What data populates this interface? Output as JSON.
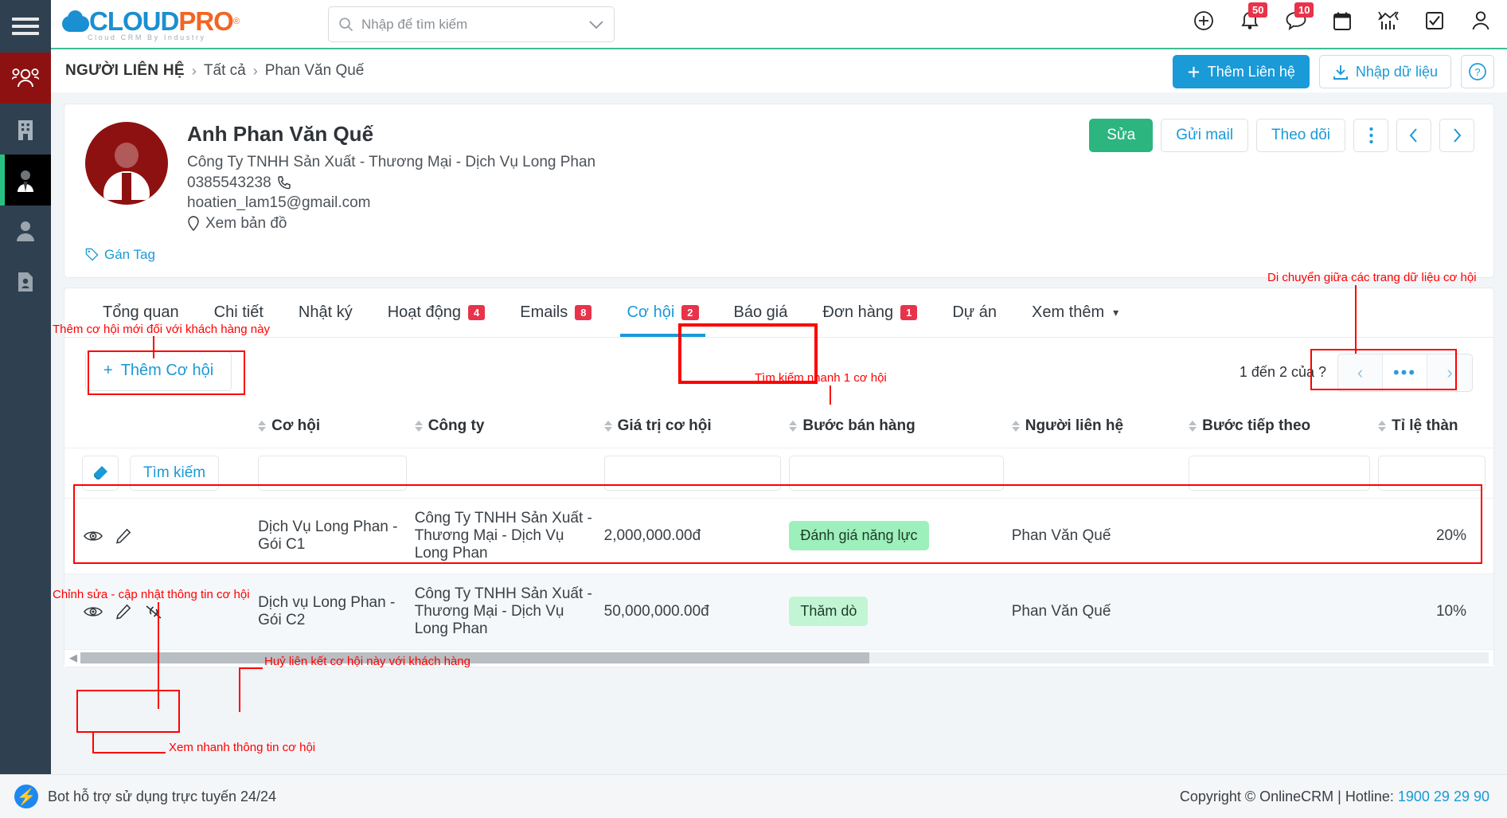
{
  "app": {
    "logo_text_1": "CLOUD",
    "logo_text_2": "PRO",
    "logo_reg": "®",
    "logo_sub": "Cloud CRM By Industry"
  },
  "search": {
    "placeholder": "Nhập để tìm kiếm",
    "value": ""
  },
  "topicons": [
    {
      "name": "add-circle-icon",
      "badge": ""
    },
    {
      "name": "bell-icon",
      "badge": "50"
    },
    {
      "name": "chat-icon",
      "badge": "10"
    },
    {
      "name": "calendar-icon",
      "badge": ""
    },
    {
      "name": "chart-icon",
      "badge": ""
    },
    {
      "name": "checkbox-icon",
      "badge": ""
    },
    {
      "name": "user-icon",
      "badge": ""
    }
  ],
  "breadcrumb": {
    "module": "NGƯỜI LIÊN HỆ",
    "sep": "›",
    "level1": "Tất cả",
    "level2": "Phan Văn Quế"
  },
  "breadcrumb_actions": {
    "add_contact": "Thêm Liên hệ",
    "import_data": "Nhập dữ liệu",
    "help": "?"
  },
  "contact": {
    "name": "Anh Phan Văn Quế",
    "company": "Công Ty TNHH Sản Xuất - Thương Mại - Dịch Vụ Long Phan",
    "phone": "0385543238",
    "email": "hoatien_lam15@gmail.com",
    "map_link": "Xem bản đồ",
    "tag_link": "Gán Tag",
    "actions": {
      "edit": "Sửa",
      "send_mail": "Gửi mail",
      "follow": "Theo dõi",
      "more": "⋮",
      "prev": "‹",
      "next": "›"
    }
  },
  "tabs": [
    {
      "label": "Tổng quan",
      "count": "",
      "active": false
    },
    {
      "label": "Chi tiết",
      "count": "",
      "active": false
    },
    {
      "label": "Nhật ký",
      "count": "",
      "active": false
    },
    {
      "label": "Hoạt động",
      "count": "4",
      "active": false
    },
    {
      "label": "Emails",
      "count": "8",
      "active": false
    },
    {
      "label": "Cơ hội",
      "count": "2",
      "active": true
    },
    {
      "label": "Báo giá",
      "count": "",
      "active": false
    },
    {
      "label": "Đơn hàng",
      "count": "1",
      "active": false
    },
    {
      "label": "Dự án",
      "count": "",
      "active": false
    },
    {
      "label": "Xem thêm",
      "count": "",
      "active": false,
      "chevron": true
    }
  ],
  "toolbar": {
    "add_opportunity": "Thêm Cơ hội",
    "plus": "+"
  },
  "pagination": {
    "label": "1 đến 2 của  ?",
    "prev": "‹",
    "middle": "•••",
    "next": "›"
  },
  "table": {
    "search_row": {
      "eraser_icon": "eraser-icon",
      "search_button": "Tìm kiếm",
      "filters": [
        "",
        "",
        "",
        "",
        "",
        "",
        ""
      ]
    },
    "columns": [
      {
        "label": "",
        "sortable": false
      },
      {
        "label": "Cơ hội",
        "sortable": true
      },
      {
        "label": "Công ty",
        "sortable": true
      },
      {
        "label": "Giá trị cơ hội",
        "sortable": true
      },
      {
        "label": "Bước bán hàng",
        "sortable": true
      },
      {
        "label": "Người liên hệ",
        "sortable": true
      },
      {
        "label": "Bước tiếp theo",
        "sortable": true
      },
      {
        "label": "Tỉ lệ thàn",
        "sortable": true
      }
    ],
    "rows": [
      {
        "opportunity": "Dịch Vụ Long Phan - Gói C1",
        "company": "Công Ty TNHH Sản Xuất - Thương Mại - Dịch Vụ Long Phan",
        "value": "2,000,000.00đ",
        "stage": "Đánh giá năng lực",
        "contact": "Phan Văn Quế",
        "next_step": "",
        "rate": "20%",
        "actions": [
          "eye-icon",
          "pencil-icon"
        ]
      },
      {
        "opportunity": "Dịch vụ Long Phan - Gói C2",
        "company": "Công Ty TNHH Sản Xuất - Thương Mại - Dịch Vụ Long Phan",
        "value": "50,000,000.00đ",
        "stage": "Thăm dò",
        "contact": "Phan Văn Quế",
        "next_step": "",
        "rate": "10%",
        "actions": [
          "eye-icon",
          "pencil-icon",
          "unlink-icon"
        ]
      }
    ]
  },
  "annotations": {
    "a_pager": "Di chuyển giữa các trang dữ liệu cơ hội",
    "a_add": "Thêm cơ hội mới đối với khách hàng này",
    "a_quicksearch": "Tìm kiếm nhanh 1 cơ hội",
    "a_edit": "Chỉnh sửa - cập nhật thông tin cơ hội",
    "a_unlink": "Huỷ liên kết cơ hội này với khách hàng",
    "a_quickview": "Xem nhanh thông tin cơ hội"
  },
  "footer": {
    "bot_text": "Bot hỗ trợ sử dụng trực tuyến 24/24",
    "copyright": "Copyright © OnlineCRM | Hotline: ",
    "hotline": "1900 29 29 90"
  },
  "colors": {
    "accent_blue": "#1a9ad7",
    "green": "#2cb57e",
    "badge_red": "#e8334a",
    "rail_dark": "#2f4050",
    "rail_active_red": "#8e1111",
    "annotation_red": "#ff0000"
  }
}
